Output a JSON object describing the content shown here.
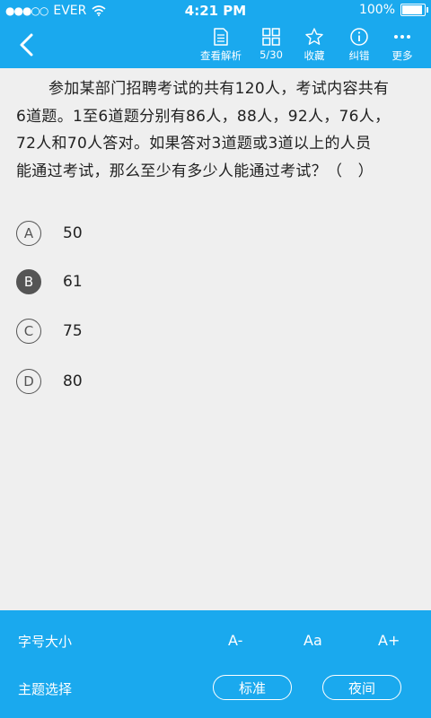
{
  "status_bar": {
    "signal": "●●●○○",
    "carrier": "EVER",
    "time": "4:21 PM",
    "battery_text": "100%",
    "battery_level": 1.0
  },
  "toolbar": {
    "items": [
      {
        "label": "查看解析",
        "icon": "document-icon"
      },
      {
        "label": "5/30",
        "icon": "grid-icon"
      },
      {
        "label": "收藏",
        "icon": "star-icon"
      },
      {
        "label": "纠错",
        "icon": "info-icon"
      },
      {
        "label": "更多",
        "icon": "more-icon"
      }
    ]
  },
  "question": {
    "text": "参加某部门招聘考试的共有120人，考试内容共有6道题。1至6道题分别有86人，88人，92人，76人，72人和70人答对。如果答对3道题或3道以上的人员能通过考试，那么至少有多少人能通过考试？（　）",
    "lines": [
      "参加某部门招聘考试的共有120人，考试内容共有",
      "6道题。1至6道题分别有86人，88人，92人，76人，",
      "72人和70人答对。如果答对3道题或3道以上的人员",
      "能通过考试，那么至少有多少人能通过考试？（　）"
    ]
  },
  "options": [
    {
      "letter": "A",
      "value": "50",
      "selected": false
    },
    {
      "letter": "B",
      "value": "61",
      "selected": true
    },
    {
      "letter": "C",
      "value": "75",
      "selected": false
    },
    {
      "letter": "D",
      "value": "80",
      "selected": false
    }
  ],
  "settings": {
    "font_size_label": "字号大小",
    "font_smaller": "A-",
    "font_normal": "Aa",
    "font_larger": "A+",
    "theme_label": "主题选择",
    "theme_standard": "标准",
    "theme_night": "夜间"
  },
  "colors": {
    "accent": "#1aa9ee",
    "background": "#efefef",
    "selected_option": "#555555"
  }
}
